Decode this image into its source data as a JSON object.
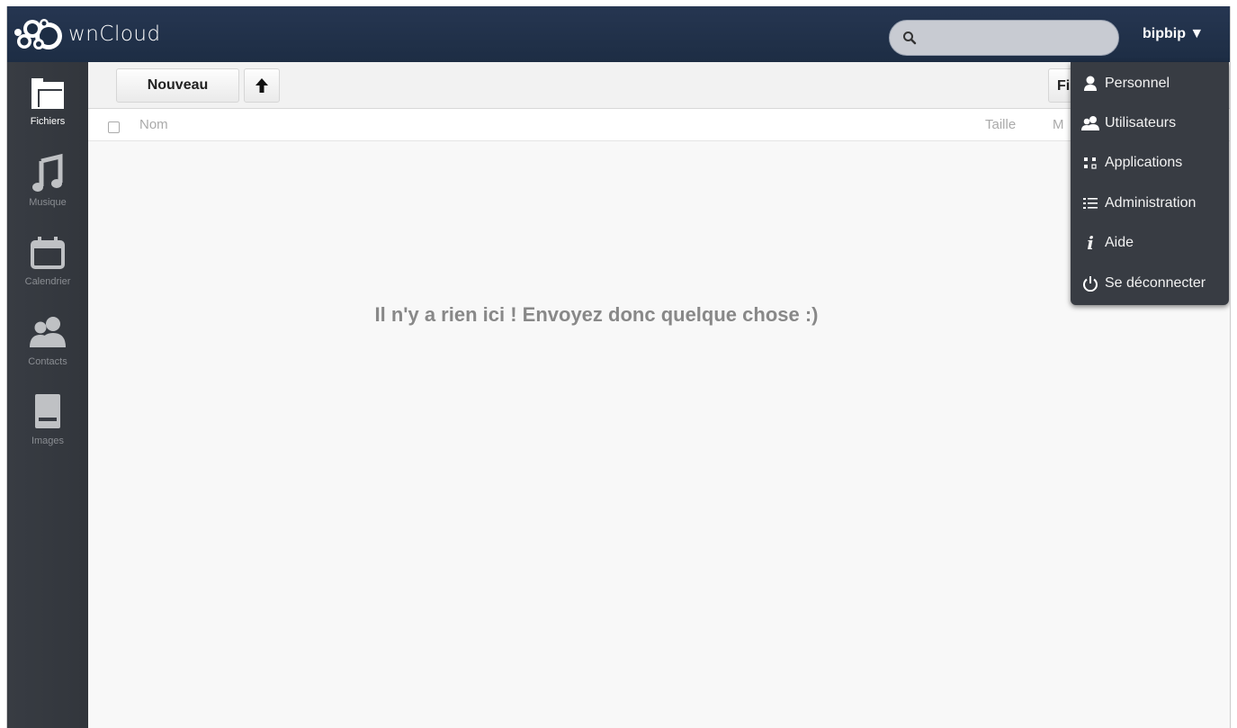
{
  "header": {
    "logo_text": "wnCloud",
    "search_placeholder": "",
    "user_name": "bipbip ▼"
  },
  "nav": {
    "items": [
      {
        "label": "Fichiers",
        "icon": "folder-icon",
        "active": true
      },
      {
        "label": "Musique",
        "icon": "music-note-icon"
      },
      {
        "label": "Calendrier",
        "icon": "calendar-icon"
      },
      {
        "label": "Contacts",
        "icon": "contacts-icon"
      },
      {
        "label": "Images",
        "icon": "image-icon"
      }
    ]
  },
  "controls": {
    "new_label": "Nouveau",
    "upload_icon": "upload-arrow-icon",
    "partial_button_label": "Fi"
  },
  "file_list": {
    "col_name": "Nom",
    "col_size": "Taille",
    "col_modified": "M",
    "empty_message": "Il n'y a rien ici ! Envoyez donc quelque chose :)"
  },
  "user_menu": {
    "items": [
      {
        "label": "Personnel",
        "icon": "person-icon"
      },
      {
        "label": "Utilisateurs",
        "icon": "users-icon"
      },
      {
        "label": "Applications",
        "icon": "apps-icon"
      },
      {
        "label": "Administration",
        "icon": "list-icon"
      },
      {
        "label": "Aide",
        "icon": "info-icon"
      },
      {
        "label": "Se déconnecter",
        "icon": "power-icon"
      }
    ]
  },
  "colors": {
    "header_bg": "#1d2d44",
    "nav_bg": "#383c43",
    "menu_bg": "#383c43",
    "content_bg": "#f8f8f8"
  }
}
